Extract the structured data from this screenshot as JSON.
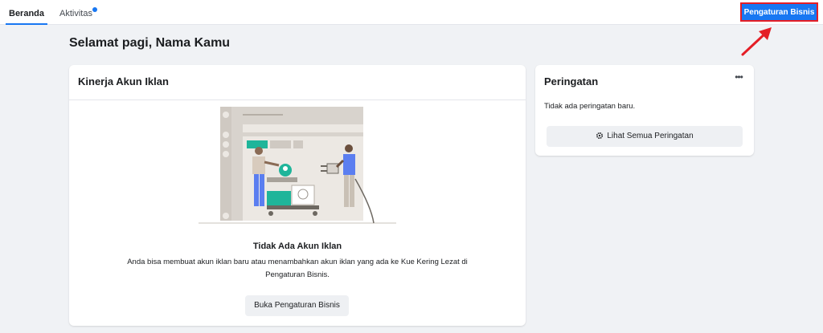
{
  "tabs": [
    {
      "label": "Beranda",
      "active": true
    },
    {
      "label": "Aktivitas",
      "active": false
    }
  ],
  "header": {
    "business_settings_button": "Pengaturan Bisnis"
  },
  "greeting": "Selamat pagi, Nama Kamu",
  "ad_account_card": {
    "title": "Kinerja Akun Iklan",
    "empty_title": "Tidak Ada Akun Iklan",
    "empty_description": "Anda bisa membuat akun iklan baru atau menambahkan akun iklan yang ada ke Kue Kering Lezat di Pengaturan Bisnis.",
    "open_button": "Buka Pengaturan Bisnis"
  },
  "alerts_card": {
    "title": "Peringatan",
    "more_icon": "more-horizontal-icon",
    "no_alerts_text": "Tidak ada peringatan baru.",
    "see_all_button": "Lihat Semua Peringatan",
    "see_all_icon": "gear-icon"
  },
  "colors": {
    "primary": "#1877f2",
    "highlight_border": "#e41e26",
    "background": "#f0f2f5"
  }
}
